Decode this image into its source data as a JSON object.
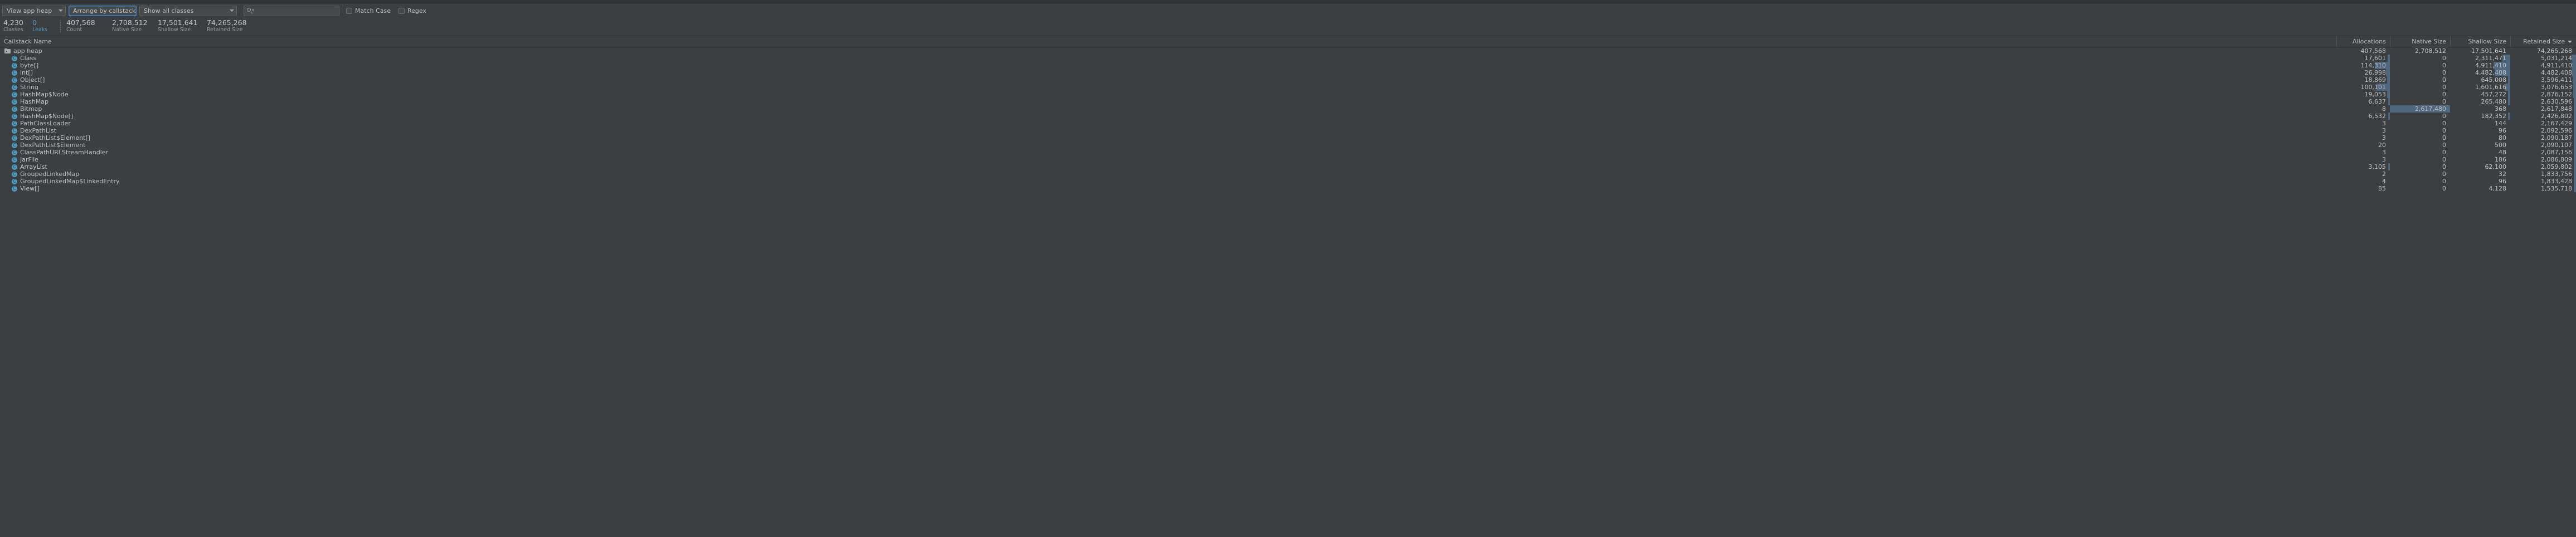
{
  "toolbar": {
    "heap_select": {
      "label": "View app heap",
      "icon": "chevron-down-icon"
    },
    "arrange_select": {
      "label": "Arrange by callstack",
      "icon": "chevron-down-icon"
    },
    "classes_select": {
      "label": "Show all classes",
      "icon": "chevron-down-icon"
    },
    "search": {
      "value": "",
      "placeholder": "",
      "icon": "search-icon"
    },
    "match_case": {
      "label": "Match Case",
      "checked": false
    },
    "regex": {
      "label": "Regex",
      "checked": false
    }
  },
  "stats": [
    {
      "value": "4,230",
      "label": "Classes",
      "accent": false
    },
    {
      "value": "0",
      "label": "Leaks",
      "accent": true
    },
    {
      "value": "407,568",
      "label": "Count",
      "accent": false
    },
    {
      "value": "2,708,512",
      "label": "Native Size",
      "accent": false
    },
    {
      "value": "17,501,641",
      "label": "Shallow Size",
      "accent": false
    },
    {
      "value": "74,265,268",
      "label": "Retained Size",
      "accent": false
    }
  ],
  "table": {
    "columns": [
      {
        "key": "name",
        "label": "Callstack Name",
        "sorted": false
      },
      {
        "key": "allocations",
        "label": "Allocations",
        "sorted": false
      },
      {
        "key": "native",
        "label": "Native Size",
        "sorted": false
      },
      {
        "key": "shallow",
        "label": "Shallow Size",
        "sorted": false
      },
      {
        "key": "retained",
        "label": "Retained Size",
        "sorted": true,
        "sort_dir": "desc"
      }
    ],
    "rows": [
      {
        "name": "app heap",
        "icon": "folder-icon",
        "level": 0,
        "allocations": "407,568",
        "native": "2,708,512",
        "shallow": "17,501,641",
        "retained": "74,265,268",
        "bars": {
          "allocations": 0,
          "native": 0,
          "shallow": 0,
          "retained": 0
        }
      },
      {
        "name": "Class",
        "icon": "class-icon",
        "level": 1,
        "allocations": "17,601",
        "native": "0",
        "shallow": "2,311,471",
        "retained": "5,031,214",
        "bars": {
          "allocations": 0.04,
          "native": 0,
          "shallow": 0.13,
          "retained": 0.07
        }
      },
      {
        "name": "byte[]",
        "icon": "class-icon",
        "level": 1,
        "allocations": "114,310",
        "native": "0",
        "shallow": "4,911,410",
        "retained": "4,911,410",
        "bars": {
          "allocations": 0.28,
          "native": 0,
          "shallow": 0.28,
          "retained": 0.07
        }
      },
      {
        "name": "int[]",
        "icon": "class-icon",
        "level": 1,
        "allocations": "26,998",
        "native": "0",
        "shallow": "4,482,408",
        "retained": "4,482,408",
        "bars": {
          "allocations": 0.07,
          "native": 0,
          "shallow": 0.26,
          "retained": 0.06
        }
      },
      {
        "name": "Object[]",
        "icon": "class-icon",
        "level": 1,
        "allocations": "18,869",
        "native": "0",
        "shallow": "645,008",
        "retained": "3,596,411",
        "bars": {
          "allocations": 0.05,
          "native": 0,
          "shallow": 0.04,
          "retained": 0.05
        }
      },
      {
        "name": "String",
        "icon": "class-icon",
        "level": 1,
        "allocations": "100,101",
        "native": "0",
        "shallow": "1,601,616",
        "retained": "3,076,653",
        "bars": {
          "allocations": 0.25,
          "native": 0,
          "shallow": 0.09,
          "retained": 0.04
        }
      },
      {
        "name": "HashMap$Node",
        "icon": "class-icon",
        "level": 1,
        "allocations": "19,053",
        "native": "0",
        "shallow": "457,272",
        "retained": "2,876,152",
        "bars": {
          "allocations": 0.05,
          "native": 0,
          "shallow": 0.03,
          "retained": 0.04
        }
      },
      {
        "name": "HashMap",
        "icon": "class-icon",
        "level": 1,
        "allocations": "6,637",
        "native": "0",
        "shallow": "265,480",
        "retained": "2,630,596",
        "bars": {
          "allocations": 0.02,
          "native": 0,
          "shallow": 0.02,
          "retained": 0.035
        }
      },
      {
        "name": "Bitmap",
        "icon": "class-icon",
        "level": 1,
        "allocations": "8",
        "native": "2,617,480",
        "shallow": "368",
        "retained": "2,617,848",
        "bars": {
          "allocations": 0,
          "native": 1.0,
          "shallow": 0,
          "retained": 0.035
        }
      },
      {
        "name": "HashMap$Node[]",
        "icon": "class-icon",
        "level": 1,
        "allocations": "6,532",
        "native": "0",
        "shallow": "182,352",
        "retained": "2,426,802",
        "bars": {
          "allocations": 0.02,
          "native": 0,
          "shallow": 0.01,
          "retained": 0.033
        }
      },
      {
        "name": "PathClassLoader",
        "icon": "class-icon",
        "level": 1,
        "allocations": "3",
        "native": "0",
        "shallow": "144",
        "retained": "2,167,429",
        "bars": {
          "allocations": 0,
          "native": 0,
          "shallow": 0,
          "retained": 0.029
        }
      },
      {
        "name": "DexPathList",
        "icon": "class-icon",
        "level": 1,
        "allocations": "3",
        "native": "0",
        "shallow": "96",
        "retained": "2,092,596",
        "bars": {
          "allocations": 0,
          "native": 0,
          "shallow": 0,
          "retained": 0.028
        }
      },
      {
        "name": "DexPathList$Element[]",
        "icon": "class-icon",
        "level": 1,
        "allocations": "3",
        "native": "0",
        "shallow": "80",
        "retained": "2,090,187",
        "bars": {
          "allocations": 0,
          "native": 0,
          "shallow": 0,
          "retained": 0.028
        }
      },
      {
        "name": "DexPathList$Element",
        "icon": "class-icon",
        "level": 1,
        "allocations": "20",
        "native": "0",
        "shallow": "500",
        "retained": "2,090,107",
        "bars": {
          "allocations": 0,
          "native": 0,
          "shallow": 0,
          "retained": 0.028
        }
      },
      {
        "name": "ClassPathURLStreamHandler",
        "icon": "class-icon",
        "level": 1,
        "allocations": "3",
        "native": "0",
        "shallow": "48",
        "retained": "2,087,156",
        "bars": {
          "allocations": 0,
          "native": 0,
          "shallow": 0,
          "retained": 0.028
        }
      },
      {
        "name": "JarFile",
        "icon": "class-icon",
        "level": 1,
        "allocations": "3",
        "native": "0",
        "shallow": "186",
        "retained": "2,086,809",
        "bars": {
          "allocations": 0,
          "native": 0,
          "shallow": 0,
          "retained": 0.028
        }
      },
      {
        "name": "ArrayList",
        "icon": "class-icon",
        "level": 1,
        "allocations": "3,105",
        "native": "0",
        "shallow": "62,100",
        "retained": "2,059,802",
        "bars": {
          "allocations": 0.01,
          "native": 0,
          "shallow": 0,
          "retained": 0.027
        }
      },
      {
        "name": "GroupedLinkedMap",
        "icon": "class-icon",
        "level": 1,
        "allocations": "2",
        "native": "0",
        "shallow": "32",
        "retained": "1,833,756",
        "bars": {
          "allocations": 0,
          "native": 0,
          "shallow": 0,
          "retained": 0.024
        }
      },
      {
        "name": "GroupedLinkedMap$LinkedEntry",
        "icon": "class-icon",
        "level": 1,
        "allocations": "4",
        "native": "0",
        "shallow": "96",
        "retained": "1,833,428",
        "bars": {
          "allocations": 0,
          "native": 0,
          "shallow": 0,
          "retained": 0.024
        }
      },
      {
        "name": "View[]",
        "icon": "class-icon",
        "level": 1,
        "allocations": "85",
        "native": "0",
        "shallow": "4,128",
        "retained": "1,535,718",
        "bars": {
          "allocations": 0,
          "native": 0,
          "shallow": 0,
          "retained": 0.02
        }
      }
    ]
  }
}
